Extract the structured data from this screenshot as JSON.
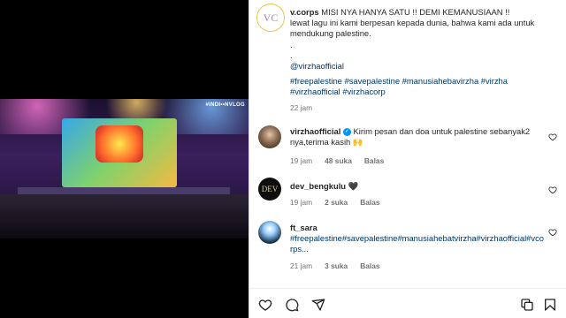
{
  "media": {
    "overlay_tag": "#INDI••NVLOG"
  },
  "post": {
    "avatar_text": "VC",
    "author": "v.corps",
    "caption_line1": "MISI NYA HANYA SATU !! DEMI KEMANUSIAAN !!",
    "caption_line2": "lewat lagu ini kami berpesan kepada dunia, bahwa kami ada untuk mendukung palestine.",
    "dot1": ".",
    "dot2": ".",
    "mention": "@virzhaofficial",
    "hashtags": "#freepalestine #savepalestine #manusiahebavirzha #virzha #virzhaofficial #virzhacorp",
    "time": "22 jam"
  },
  "comments": [
    {
      "user": "virzhaofficial",
      "verified_icon": "verified-badge-icon",
      "text": "Kirim pesan dan doa untuk palestine sebanyak2 nya,terima kasih 🙌",
      "time": "19 jam",
      "likes": "48 suka",
      "reply": "Balas"
    },
    {
      "user": "dev_bengkulu",
      "avatar_text": "DEV",
      "text": "🖤",
      "time": "19 jam",
      "likes": "2 suka",
      "reply": "Balas"
    },
    {
      "user": "ft_sara",
      "text": "#freepalestine#savepalestine#manusiahebatvirzha#virzhaofficial#vcorps...",
      "time": "21 jam",
      "likes": "3 suka",
      "reply": "Balas"
    }
  ],
  "icons": {
    "like": "heart-icon",
    "comment": "comment-icon",
    "share": "share-icon",
    "save": "bookmark-icon",
    "copy": "copy-icon"
  }
}
